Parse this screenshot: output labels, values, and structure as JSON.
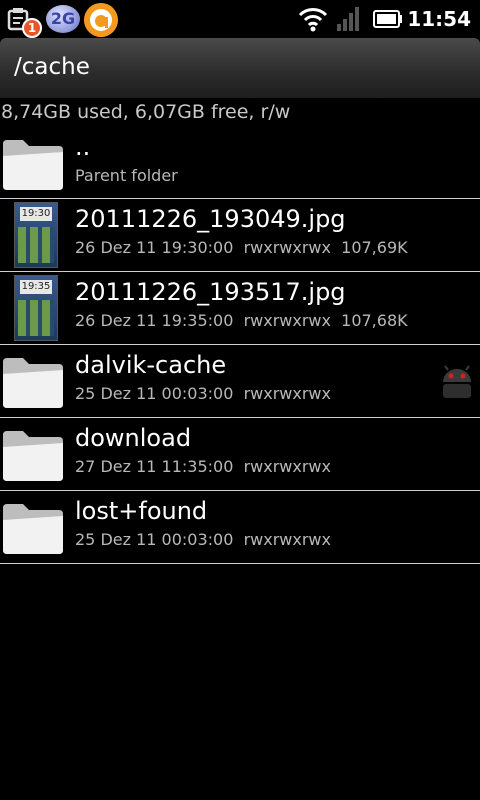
{
  "status_bar": {
    "notification_count": "1",
    "network_label": "2G",
    "time": "11:54"
  },
  "header": {
    "title": "/cache"
  },
  "storage_info": "8,74GB used, 6,07GB free, r/w",
  "items": [
    {
      "name": "..",
      "meta": "Parent folder",
      "type": "folder"
    },
    {
      "name": "20111226_193049.jpg",
      "meta": "26 Dez 11 19:30:00  rwxrwxrwx  107,69K",
      "type": "image",
      "thumb_time": "19:30"
    },
    {
      "name": "20111226_193517.jpg",
      "meta": "26 Dez 11 19:35:00  rwxrwxrwx  107,68K",
      "type": "image",
      "thumb_time": "19:35"
    },
    {
      "name": "dalvik-cache",
      "meta": "25 Dez 11 00:03:00  rwxrwxrwx",
      "type": "folder",
      "badge_icon": "android-icon"
    },
    {
      "name": "download",
      "meta": "27 Dez 11 11:35:00  rwxrwxrwx",
      "type": "folder"
    },
    {
      "name": "lost+found",
      "meta": "25 Dez 11 00:03:00  rwxrwxrwx",
      "type": "folder"
    }
  ]
}
